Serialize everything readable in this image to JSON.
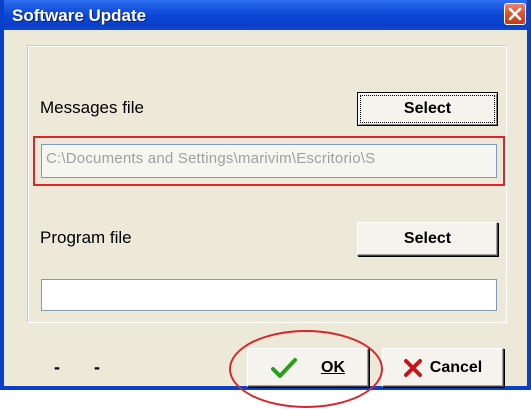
{
  "window": {
    "title": "Software Update"
  },
  "messages": {
    "label": "Messages file",
    "select_label": "Select",
    "path_value": "C:\\Documents and Settings\\marivim\\Escritorio\\S"
  },
  "program": {
    "label": "Program file",
    "select_label": "Select",
    "path_value": ""
  },
  "footer": {
    "status_left": "-",
    "status_right": "-",
    "ok_label": "OK",
    "cancel_label": "Cancel"
  },
  "colors": {
    "titlebar": "#0A46D4",
    "dialog_bg": "#ECE9D8",
    "annotation": "#D8262C",
    "ok_check": "#2E9A1E",
    "cancel_x": "#C8141A"
  },
  "icons": {
    "close": "close-icon",
    "ok": "checkmark-icon",
    "cancel": "x-icon"
  }
}
